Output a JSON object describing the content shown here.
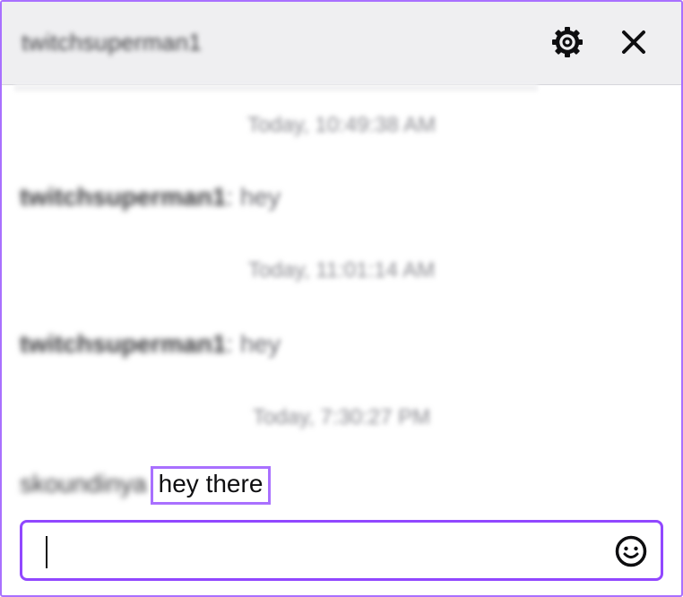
{
  "header": {
    "title": "twitchsuperman1",
    "icons": {
      "settings": "gear-icon",
      "close": "close-icon"
    }
  },
  "messages": [
    {
      "timestamp": "Today, 10:49:38 AM",
      "user": "twitchsuperman1",
      "text": "hey"
    },
    {
      "timestamp": "Today, 11:01:14 AM",
      "user": "twitchsuperman1",
      "text": "hey"
    },
    {
      "timestamp": "Today, 7:30:27 PM",
      "user": "skoundinya",
      "text": "hey there"
    }
  ],
  "input": {
    "value": "",
    "placeholder": "",
    "emoji_icon": "smiley-icon"
  },
  "colors": {
    "accent": "#9147ff",
    "highlight": "#a970ff",
    "header_bg": "#efeff1"
  }
}
